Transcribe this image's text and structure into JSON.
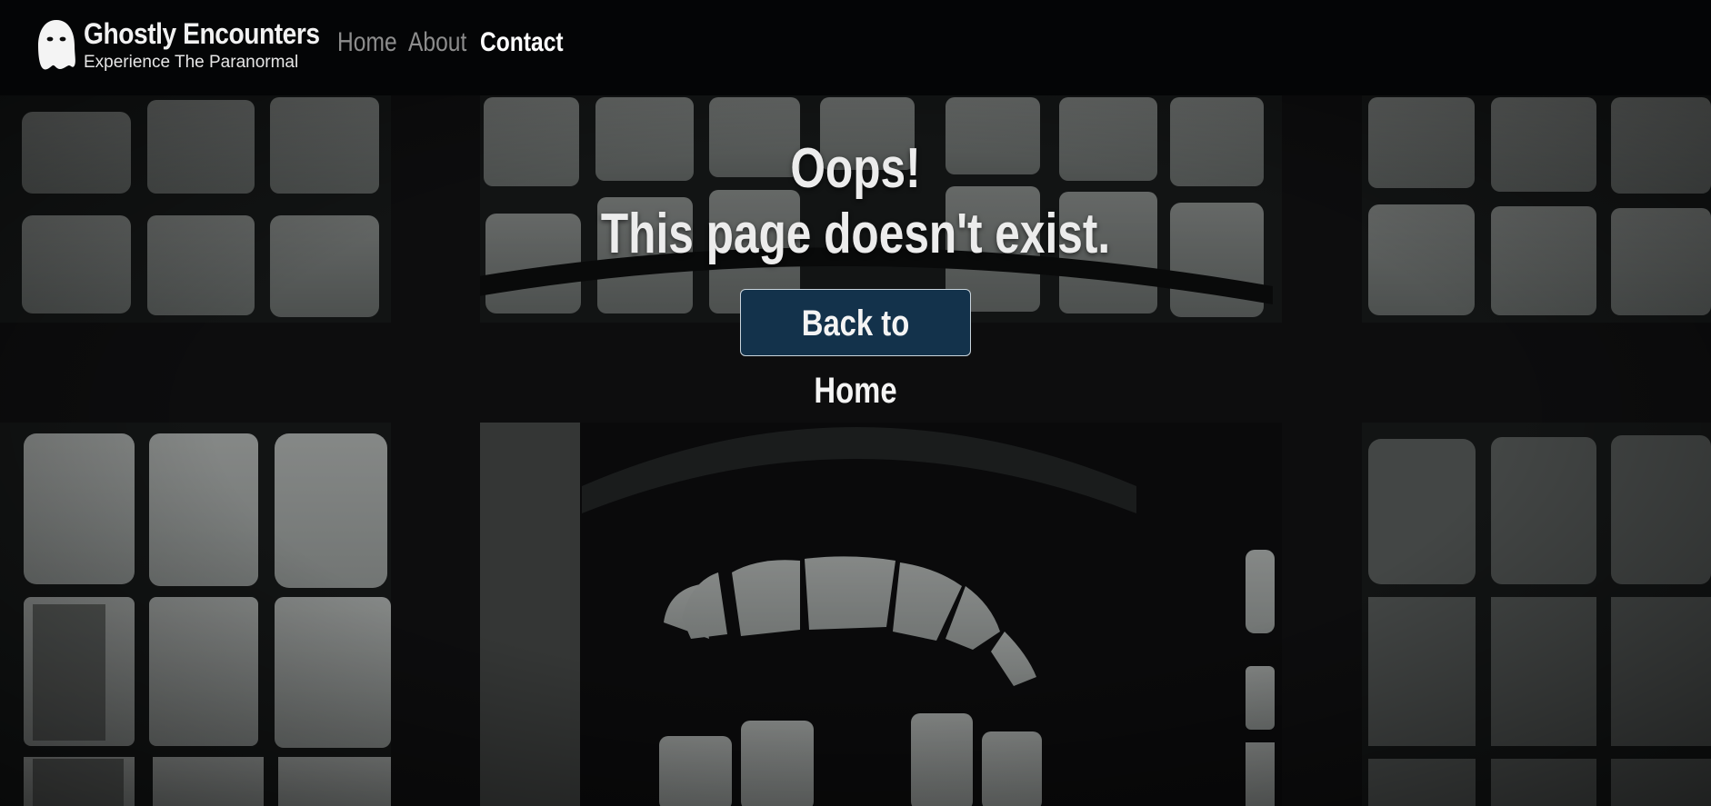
{
  "header": {
    "brand_title": "Ghostly Encounters",
    "brand_tagline": "Experience The Paranormal",
    "logo_icon": "ghost-icon",
    "nav": {
      "home": "Home",
      "about": "About",
      "contact": "Contact"
    },
    "active_nav": "contact"
  },
  "hero": {
    "title_line1": "Oops!",
    "title_line2": "This page doesn't exist.",
    "button_label": "Back to Home"
  },
  "colors": {
    "header_bg": "#040506",
    "button_bg": "#13324b",
    "text_light": "#ececec",
    "nav_inactive": "#8d8d8d"
  }
}
